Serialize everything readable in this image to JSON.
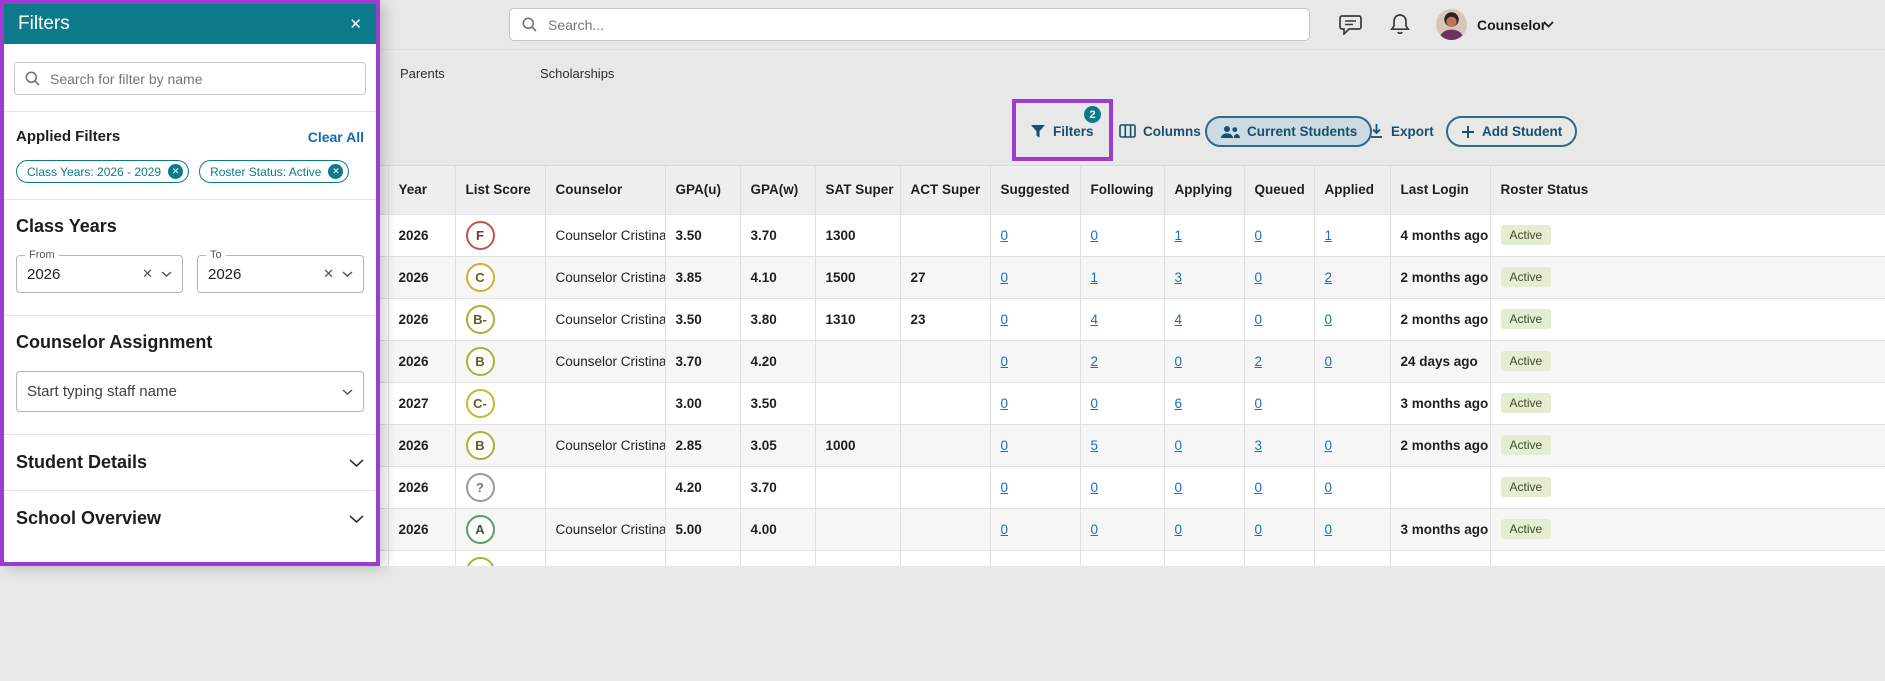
{
  "colors": {
    "teal": "#0d7a8c",
    "highlight_purple": "#9e3bd0",
    "link_blue": "#1a6dbf",
    "button_teal": "#17506e",
    "active_badge_bg": "#e4edd2"
  },
  "topbar": {
    "search_placeholder": "Search...",
    "user_label": "Counselor"
  },
  "nav": {
    "items": [
      {
        "label": "Parents"
      },
      {
        "label": "Scholarships"
      }
    ]
  },
  "toolbar": {
    "filters": {
      "label": "Filters",
      "badge": "2"
    },
    "columns": {
      "label": "Columns"
    },
    "current_students": {
      "label": "Current Students"
    },
    "export": {
      "label": "Export"
    },
    "add_student": {
      "label": "Add Student"
    }
  },
  "filters_panel": {
    "title": "Filters",
    "search_placeholder": "Search for filter by name",
    "applied": {
      "label": "Applied Filters",
      "clear_all": "Clear All",
      "chips": [
        {
          "label": "Class Years: 2026 - 2029"
        },
        {
          "label": "Roster Status: Active"
        }
      ]
    },
    "class_years": {
      "heading": "Class Years",
      "from": {
        "label": "From",
        "value": "2026"
      },
      "to": {
        "label": "To",
        "value": "2026"
      }
    },
    "counselor_assignment": {
      "heading": "Counselor Assignment",
      "placeholder": "Start typing staff name"
    },
    "collapsed_sections": [
      {
        "label": "Student Details"
      },
      {
        "label": "School Overview"
      }
    ]
  },
  "table": {
    "columns": [
      "Year",
      "List Score",
      "Counselor",
      "GPA(u)",
      "GPA(w)",
      "SAT Super",
      "ACT Super",
      "Suggested",
      "Following",
      "Applying",
      "Queued",
      "Applied",
      "Last Login",
      "Roster Status"
    ],
    "rows": [
      {
        "year": "2026",
        "score": "F",
        "score_color": "red",
        "counselor": "Counselor Cristina",
        "gpa_u": "3.50",
        "gpa_w": "3.70",
        "sat": "1300",
        "act": "",
        "suggested": "0",
        "following": "0",
        "applying": "1",
        "queued": "0",
        "applied": "1",
        "last_login": "4 months ago",
        "status": "Active"
      },
      {
        "year": "2026",
        "score": "C",
        "score_color": "yellow",
        "counselor": "Counselor Cristina",
        "gpa_u": "3.85",
        "gpa_w": "4.10",
        "sat": "1500",
        "act": "27",
        "suggested": "0",
        "following": "1",
        "applying": "3",
        "queued": "0",
        "applied": "2",
        "last_login": "2 months ago",
        "status": "Active"
      },
      {
        "year": "2026",
        "score": "B-",
        "score_color": "olive",
        "counselor": "Counselor Cristina",
        "gpa_u": "3.50",
        "gpa_w": "3.80",
        "sat": "1310",
        "act": "23",
        "suggested": "0",
        "following": "4",
        "applying": "4",
        "queued": "0",
        "applied": "0",
        "last_login": "2 months ago",
        "status": "Active"
      },
      {
        "year": "2026",
        "score": "B",
        "score_color": "olive",
        "counselor": "Counselor Cristina",
        "gpa_u": "3.70",
        "gpa_w": "4.20",
        "sat": "",
        "act": "",
        "suggested": "0",
        "following": "2",
        "applying": "0",
        "queued": "2",
        "applied": "0",
        "last_login": "24 days ago",
        "status": "Active"
      },
      {
        "year": "2027",
        "score": "C-",
        "score_color": "yellow",
        "counselor": "",
        "gpa_u": "3.00",
        "gpa_w": "3.50",
        "sat": "",
        "act": "",
        "suggested": "0",
        "following": "0",
        "applying": "6",
        "queued": "0",
        "applied": "",
        "last_login": "3 months ago",
        "status": "Active"
      },
      {
        "year": "2026",
        "score": "B",
        "score_color": "olive",
        "counselor": "Counselor Cristina",
        "gpa_u": "2.85",
        "gpa_w": "3.05",
        "sat": "1000",
        "act": "",
        "suggested": "0",
        "following": "5",
        "applying": "0",
        "queued": "3",
        "applied": "0",
        "last_login": "2 months ago",
        "status": "Active"
      },
      {
        "year": "2026",
        "score": "?",
        "score_color": "gray",
        "counselor": "",
        "gpa_u": "4.20",
        "gpa_w": "3.70",
        "sat": "",
        "act": "",
        "suggested": "0",
        "following": "0",
        "applying": "0",
        "queued": "0",
        "applied": "0",
        "last_login": "",
        "status": "Active"
      },
      {
        "year": "2026",
        "score": "A",
        "score_color": "green",
        "counselor": "Counselor Cristina",
        "gpa_u": "5.00",
        "gpa_w": "4.00",
        "sat": "",
        "act": "",
        "suggested": "0",
        "following": "0",
        "applying": "0",
        "queued": "0",
        "applied": "0",
        "last_login": "3 months ago",
        "status": "Active"
      },
      {
        "year": "",
        "score": "",
        "score_color": "olive",
        "counselor": "",
        "gpa_u": "",
        "gpa_w": "",
        "sat": "",
        "act": "",
        "suggested": "",
        "following": "",
        "applying": "",
        "queued": "",
        "applied": "",
        "last_login": "",
        "status": ""
      }
    ]
  }
}
